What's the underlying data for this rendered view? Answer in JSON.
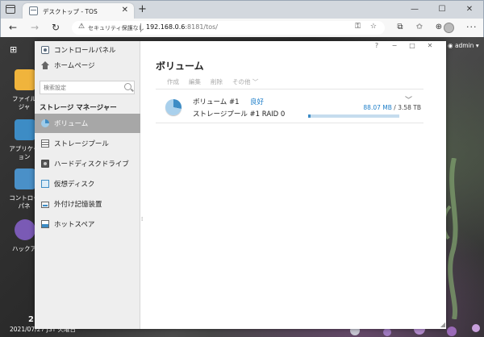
{
  "browser": {
    "tab_title": "デスクトップ - TOS",
    "tab_close": "✕",
    "new_tab": "+",
    "controls": {
      "minimize": "—",
      "maximize": "☐",
      "close": "✕"
    },
    "nav": {
      "back": "←",
      "forward": "→",
      "reload": "↻"
    },
    "security_label": "セキュリティ保護なし",
    "url_host": "192.168.0.6",
    "url_rest": ":8181/tos/",
    "menu": "···"
  },
  "desktop": {
    "icons": [
      {
        "label": "ファイル",
        "label2": "ジャ",
        "color": "#f0b43c"
      },
      {
        "label": "アプリケー",
        "label2": "ョン",
        "color": "#3d8cc5"
      },
      {
        "label": "コントロー",
        "label2": "パネ",
        "color": "#4a90c8"
      },
      {
        "label": "ハックア",
        "label2": "",
        "color": "#7a5ab5"
      }
    ],
    "user_label": "admin",
    "taskbar_num": "2",
    "date_text": "2021/07/27 JST 火曜日"
  },
  "window": {
    "controls": [
      "?",
      "−",
      "□",
      "✕"
    ],
    "sidebar": {
      "control_panel": "コントロールパネル",
      "home": "ホームページ",
      "search_placeholder": "検索設定",
      "section_title": "ストレージ マネージャー",
      "items": [
        {
          "label": "ボリューム",
          "icon": "volume-icon",
          "active": true
        },
        {
          "label": "ストレージプール",
          "icon": "storage-pool-icon",
          "active": false
        },
        {
          "label": "ハードディスクドライブ",
          "icon": "hdd-icon",
          "active": false
        },
        {
          "label": "仮想ディスク",
          "icon": "virtual-disk-icon",
          "active": false
        },
        {
          "label": "外付け記憶装置",
          "icon": "external-storage-icon",
          "active": false
        },
        {
          "label": "ホットスペア",
          "icon": "hot-spare-icon",
          "active": false
        }
      ]
    },
    "main": {
      "title": "ボリューム",
      "actions": [
        "作成",
        "編集",
        "削除",
        "その他 ﹀"
      ],
      "volume": {
        "name": "ボリューム #1",
        "status": "良好",
        "pool": "ストレージプール #1   RAID 0",
        "used": "88.07 MB",
        "sep": " / ",
        "total": "3.58 TB",
        "usage_fraction": 0.03,
        "expand": "﹀"
      }
    }
  },
  "colors": {
    "accent": "#3d8cc5",
    "status_good": "#1f7fc9",
    "sidebar_active": "#a7a7a7"
  }
}
